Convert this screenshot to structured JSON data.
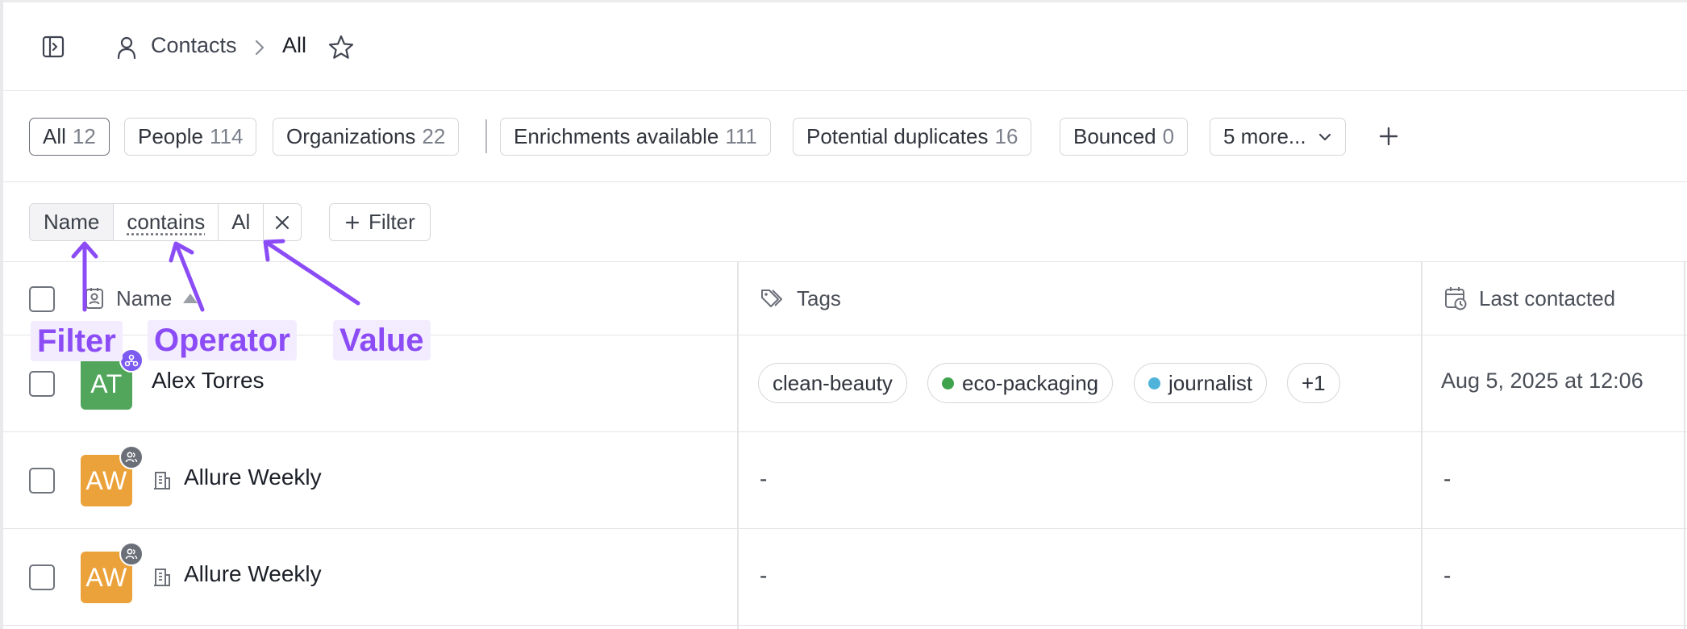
{
  "header": {
    "breadcrumb_root": "Contacts",
    "breadcrumb_current": "All"
  },
  "segments": [
    {
      "label": "All",
      "count": "12"
    },
    {
      "label": "People",
      "count": "114"
    },
    {
      "label": "Organizations",
      "count": "22"
    },
    {
      "label": "Enrichments available",
      "count": "111"
    },
    {
      "label": "Potential duplicates",
      "count": "16"
    },
    {
      "label": "Bounced",
      "count": "0"
    },
    {
      "label": "5 more..."
    }
  ],
  "filter": {
    "field": "Name",
    "operator": "contains",
    "value": "Al",
    "add_label": "Filter"
  },
  "columns": {
    "name": "Name",
    "tags": "Tags",
    "last_contacted": "Last contacted"
  },
  "rows": [
    {
      "initials": "AT",
      "avatar_color": "#52a65c",
      "badge_color": "#7c5cf0",
      "name": "Alex Torres",
      "tags": [
        {
          "label": "clean-beauty"
        },
        {
          "label": "eco-packaging",
          "color": "#3fa34d"
        },
        {
          "label": "journalist",
          "color": "#4fb3d9"
        },
        {
          "label": "+1"
        }
      ],
      "last_contacted": "Aug 5, 2025 at 12:06"
    },
    {
      "initials": "AW",
      "avatar_color": "#eba23b",
      "badge_color": "#6b6f78",
      "name": "Allure Weekly",
      "tags_text": "-",
      "last_contacted": "-"
    },
    {
      "initials": "AW",
      "avatar_color": "#eba23b",
      "badge_color": "#6b6f78",
      "name": "Allure Weekly",
      "tags_text": "-",
      "last_contacted": "-"
    }
  ],
  "annotations": {
    "filter": "Filter",
    "operator": "Operator",
    "value": "Value",
    "color": "#8b4cf6"
  }
}
